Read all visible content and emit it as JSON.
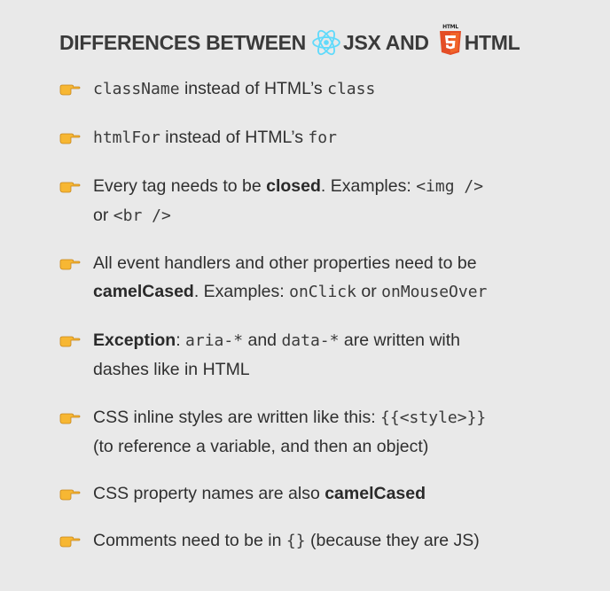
{
  "title": {
    "part1": "DIFFERENCES BETWEEN",
    "part2": "JSX AND",
    "part3": "HTML",
    "html5_badge": "HTML"
  },
  "colors": {
    "background": "#e9e9e9",
    "react_blue": "#61dafb",
    "html5_orange": "#e44d26",
    "hand_yellow": "#f7b733"
  },
  "items": [
    {
      "c1": "className",
      "t1": " instead of HTML’s ",
      "c2": "class"
    },
    {
      "c1": "htmlFor",
      "t1": " instead of HTML’s ",
      "c2": "for"
    },
    {
      "t1": "Every tag needs to be ",
      "b1": "closed",
      "t2": ". Examples: ",
      "c1": "<img />",
      "t3": "or ",
      "c2": "<br />"
    },
    {
      "t1": "All event handlers and other properties need to be",
      "b1": "camelCased",
      "t2": ". Examples: ",
      "c1": "onClick",
      "t3": " or ",
      "c2": "onMouseOver"
    },
    {
      "b1": "Exception",
      "t1": ": ",
      "c1": "aria-*",
      "t2": " and ",
      "c2": "data-*",
      "t3": " are written with",
      "t4": "dashes like in HTML"
    },
    {
      "t1": "CSS inline styles are written like this: ",
      "c1": "{{<style>}}",
      "t2": "(to reference a variable, and then an object)"
    },
    {
      "t1": "CSS property names are also ",
      "b1": "camelCased"
    },
    {
      "t1": "Comments need to be in ",
      "c1": "{}",
      "t2": " (because they are JS)"
    }
  ]
}
